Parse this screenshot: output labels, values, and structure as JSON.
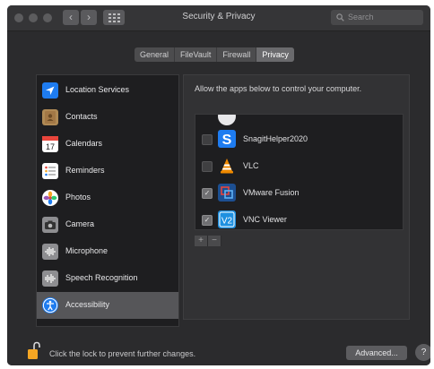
{
  "window": {
    "title": "Security & Privacy",
    "search_placeholder": "Search"
  },
  "tabs": [
    {
      "label": "General",
      "active": false
    },
    {
      "label": "FileVault",
      "active": false
    },
    {
      "label": "Firewall",
      "active": false
    },
    {
      "label": "Privacy",
      "active": true
    }
  ],
  "sidebar": {
    "items": [
      {
        "label": "Location Services",
        "icon": "location-arrow-icon"
      },
      {
        "label": "Contacts",
        "icon": "contacts-book-icon"
      },
      {
        "label": "Calendars",
        "icon": "calendar-icon"
      },
      {
        "label": "Reminders",
        "icon": "reminders-list-icon"
      },
      {
        "label": "Photos",
        "icon": "photos-flower-icon"
      },
      {
        "label": "Camera",
        "icon": "camera-icon"
      },
      {
        "label": "Microphone",
        "icon": "microphone-waveform-icon"
      },
      {
        "label": "Speech Recognition",
        "icon": "speech-waveform-icon"
      },
      {
        "label": "Accessibility",
        "icon": "accessibility-icon",
        "selected": true
      }
    ]
  },
  "panel": {
    "description": "Allow the apps below to control your computer.",
    "apps": [
      {
        "name": "SnagitHelper2020",
        "checked": false,
        "icon": "snagit-icon"
      },
      {
        "name": "VLC",
        "checked": false,
        "icon": "vlc-cone-icon"
      },
      {
        "name": "VMware Fusion",
        "checked": true,
        "icon": "vmware-fusion-icon"
      },
      {
        "name": "VNC Viewer",
        "checked": true,
        "icon": "vnc-viewer-icon"
      }
    ],
    "add_label": "+",
    "remove_label": "−",
    "check_mark": "✓"
  },
  "footer": {
    "lock_text": "Click the lock to prevent further changes.",
    "advanced_label": "Advanced...",
    "help_label": "?"
  },
  "colors": {
    "window_bg": "#2b2b2d",
    "sidebar_selected": "#565659",
    "accessibility_blue": "#1e7cf0"
  }
}
